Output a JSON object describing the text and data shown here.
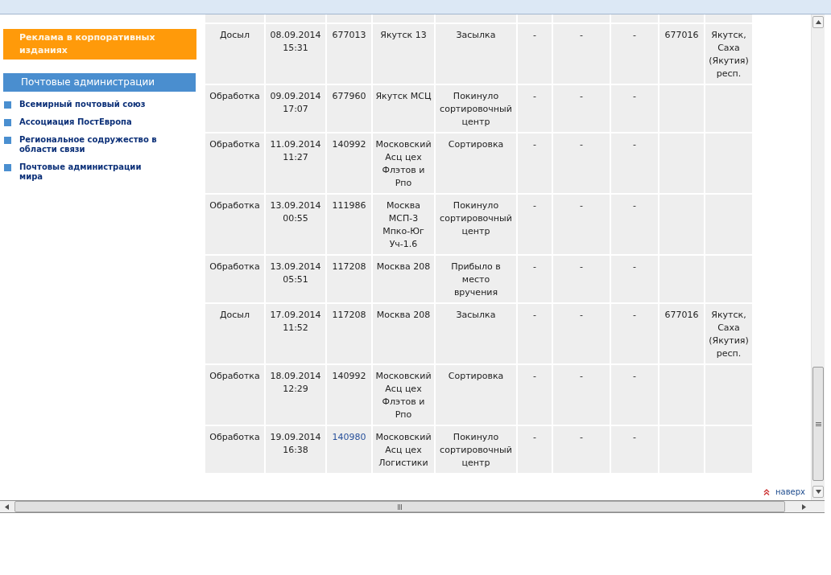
{
  "sidebar": {
    "promo_banner": "Реклама в корпоративных изданиях",
    "section_title": "Почтовые администрации",
    "links": [
      "Всемирный почтовый союз",
      "Ассоциация ПостЕвропа",
      "Региональное содружество в области связи",
      "Почтовые администрации мира"
    ]
  },
  "tracking_table": {
    "rows": [
      {
        "column_1": "Досыл",
        "column_2": "08.09.2014 15:31",
        "column_3": "677013",
        "column_3_is_link": false,
        "column_4": "Якутск 13",
        "column_5": "Засылка",
        "column_6": "-",
        "column_7": "-",
        "column_8": "-",
        "column_9": "677016",
        "column_10": "Якутск, Саха (Якутия) респ."
      },
      {
        "column_1": "Обработка",
        "column_2": "09.09.2014 17:07",
        "column_3": "677960",
        "column_3_is_link": false,
        "column_4": "Якутск МСЦ",
        "column_5": "Покинуло сортировочный центр",
        "column_6": "-",
        "column_7": "-",
        "column_8": "-"
      },
      {
        "column_1": "Обработка",
        "column_2": "11.09.2014 11:27",
        "column_3": "140992",
        "column_3_is_link": false,
        "column_4": "Московский Асц цех Флэтов и Рпо",
        "column_5": "Сортировка",
        "column_6": "-",
        "column_7": "-",
        "column_8": "-"
      },
      {
        "column_1": "Обработка",
        "column_2": "13.09.2014 00:55",
        "column_3": "111986",
        "column_3_is_link": false,
        "column_4": "Москва МСП-3 Мпко-Юг Уч-1.6",
        "column_5": "Покинуло сортировочный центр",
        "column_6": "-",
        "column_7": "-",
        "column_8": "-"
      },
      {
        "column_1": "Обработка",
        "column_2": "13.09.2014 05:51",
        "column_3": "117208",
        "column_3_is_link": false,
        "column_4": "Москва 208",
        "column_5": "Прибыло в место вручения",
        "column_6": "-",
        "column_7": "-",
        "column_8": "-"
      },
      {
        "column_1": "Досыл",
        "column_2": "17.09.2014 11:52",
        "column_3": "117208",
        "column_3_is_link": false,
        "column_4": "Москва 208",
        "column_5": "Засылка",
        "column_6": "-",
        "column_7": "-",
        "column_8": "-",
        "column_9": "677016",
        "column_10": "Якутск, Саха (Якутия) респ."
      },
      {
        "column_1": "Обработка",
        "column_2": "18.09.2014 12:29",
        "column_3": "140992",
        "column_3_is_link": false,
        "column_4": "Московский Асц цех Флэтов и Рпо",
        "column_5": "Сортировка",
        "column_6": "-",
        "column_7": "-",
        "column_8": "-"
      },
      {
        "column_1": "Обработка",
        "column_2": "19.09.2014 16:38",
        "column_3": "140980",
        "column_3_is_link": true,
        "column_4": "Московский Асц цех Логистики",
        "column_5": "Покинуло сортировочный центр",
        "column_6": "-",
        "column_7": "-",
        "column_8": "-"
      }
    ]
  },
  "back_to_top": "наверх"
}
